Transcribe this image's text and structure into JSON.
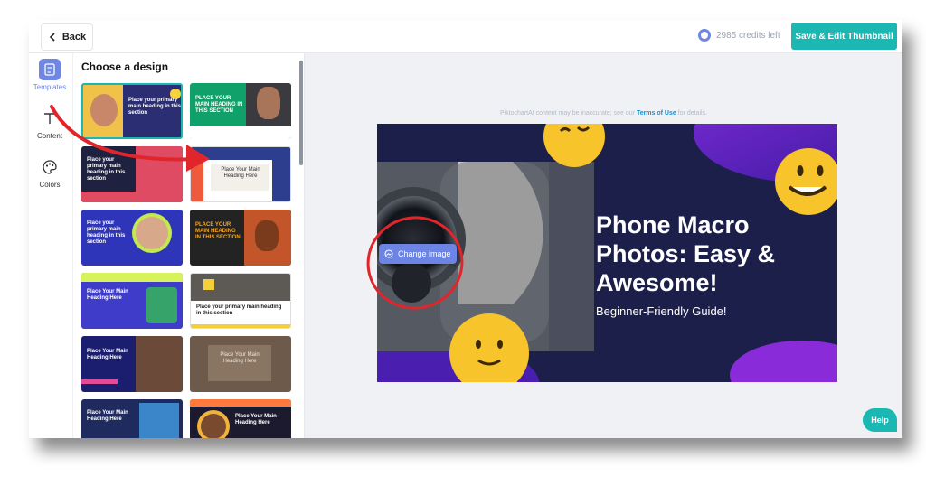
{
  "topbar": {
    "back_label": "Back",
    "credits_text": "2985 credits left",
    "save_label": "Save & Edit Thumbnail"
  },
  "rail": {
    "items": [
      {
        "label": "Templates",
        "icon": "document-icon",
        "active": true
      },
      {
        "label": "Content",
        "icon": "text-icon",
        "active": false
      },
      {
        "label": "Colors",
        "icon": "palette-icon",
        "active": false
      }
    ]
  },
  "panel": {
    "title": "Choose a design",
    "templates": [
      {
        "text": "Place your primary main heading in this section"
      },
      {
        "text": "PLACE YOUR MAIN HEADING IN THIS SECTION"
      },
      {
        "text": "Place your primary main heading in this section"
      },
      {
        "text": "Place Your Main Heading Here"
      },
      {
        "text": "Place your primary main heading in this section"
      },
      {
        "text": "PLACE YOUR MAIN HEADING IN THIS SECTION"
      },
      {
        "text": "Place Your Main Heading Here"
      },
      {
        "text": "Place your primary main heading in this section"
      },
      {
        "text": "Place Your Main Heading Here"
      },
      {
        "text": "Place Your Main Heading Here"
      },
      {
        "text": "Place Your Main Heading Here"
      },
      {
        "text": "Place Your Main Heading Here"
      }
    ]
  },
  "canvas": {
    "disclaimer_prefix": "PiktochartAI content may be inaccurate; see our ",
    "disclaimer_link": "Terms of Use",
    "disclaimer_suffix": " for details.",
    "title": "Phone Macro Photos: Easy & Awesome!",
    "subtitle": "Beginner-Friendly Guide!",
    "change_image_label": "Change image"
  },
  "help_label": "Help",
  "colors": {
    "accent": "#1ab7b3",
    "rail_active": "#6f86e3",
    "card_bg": "#1c1f4a",
    "annotation": "#e0262b"
  }
}
